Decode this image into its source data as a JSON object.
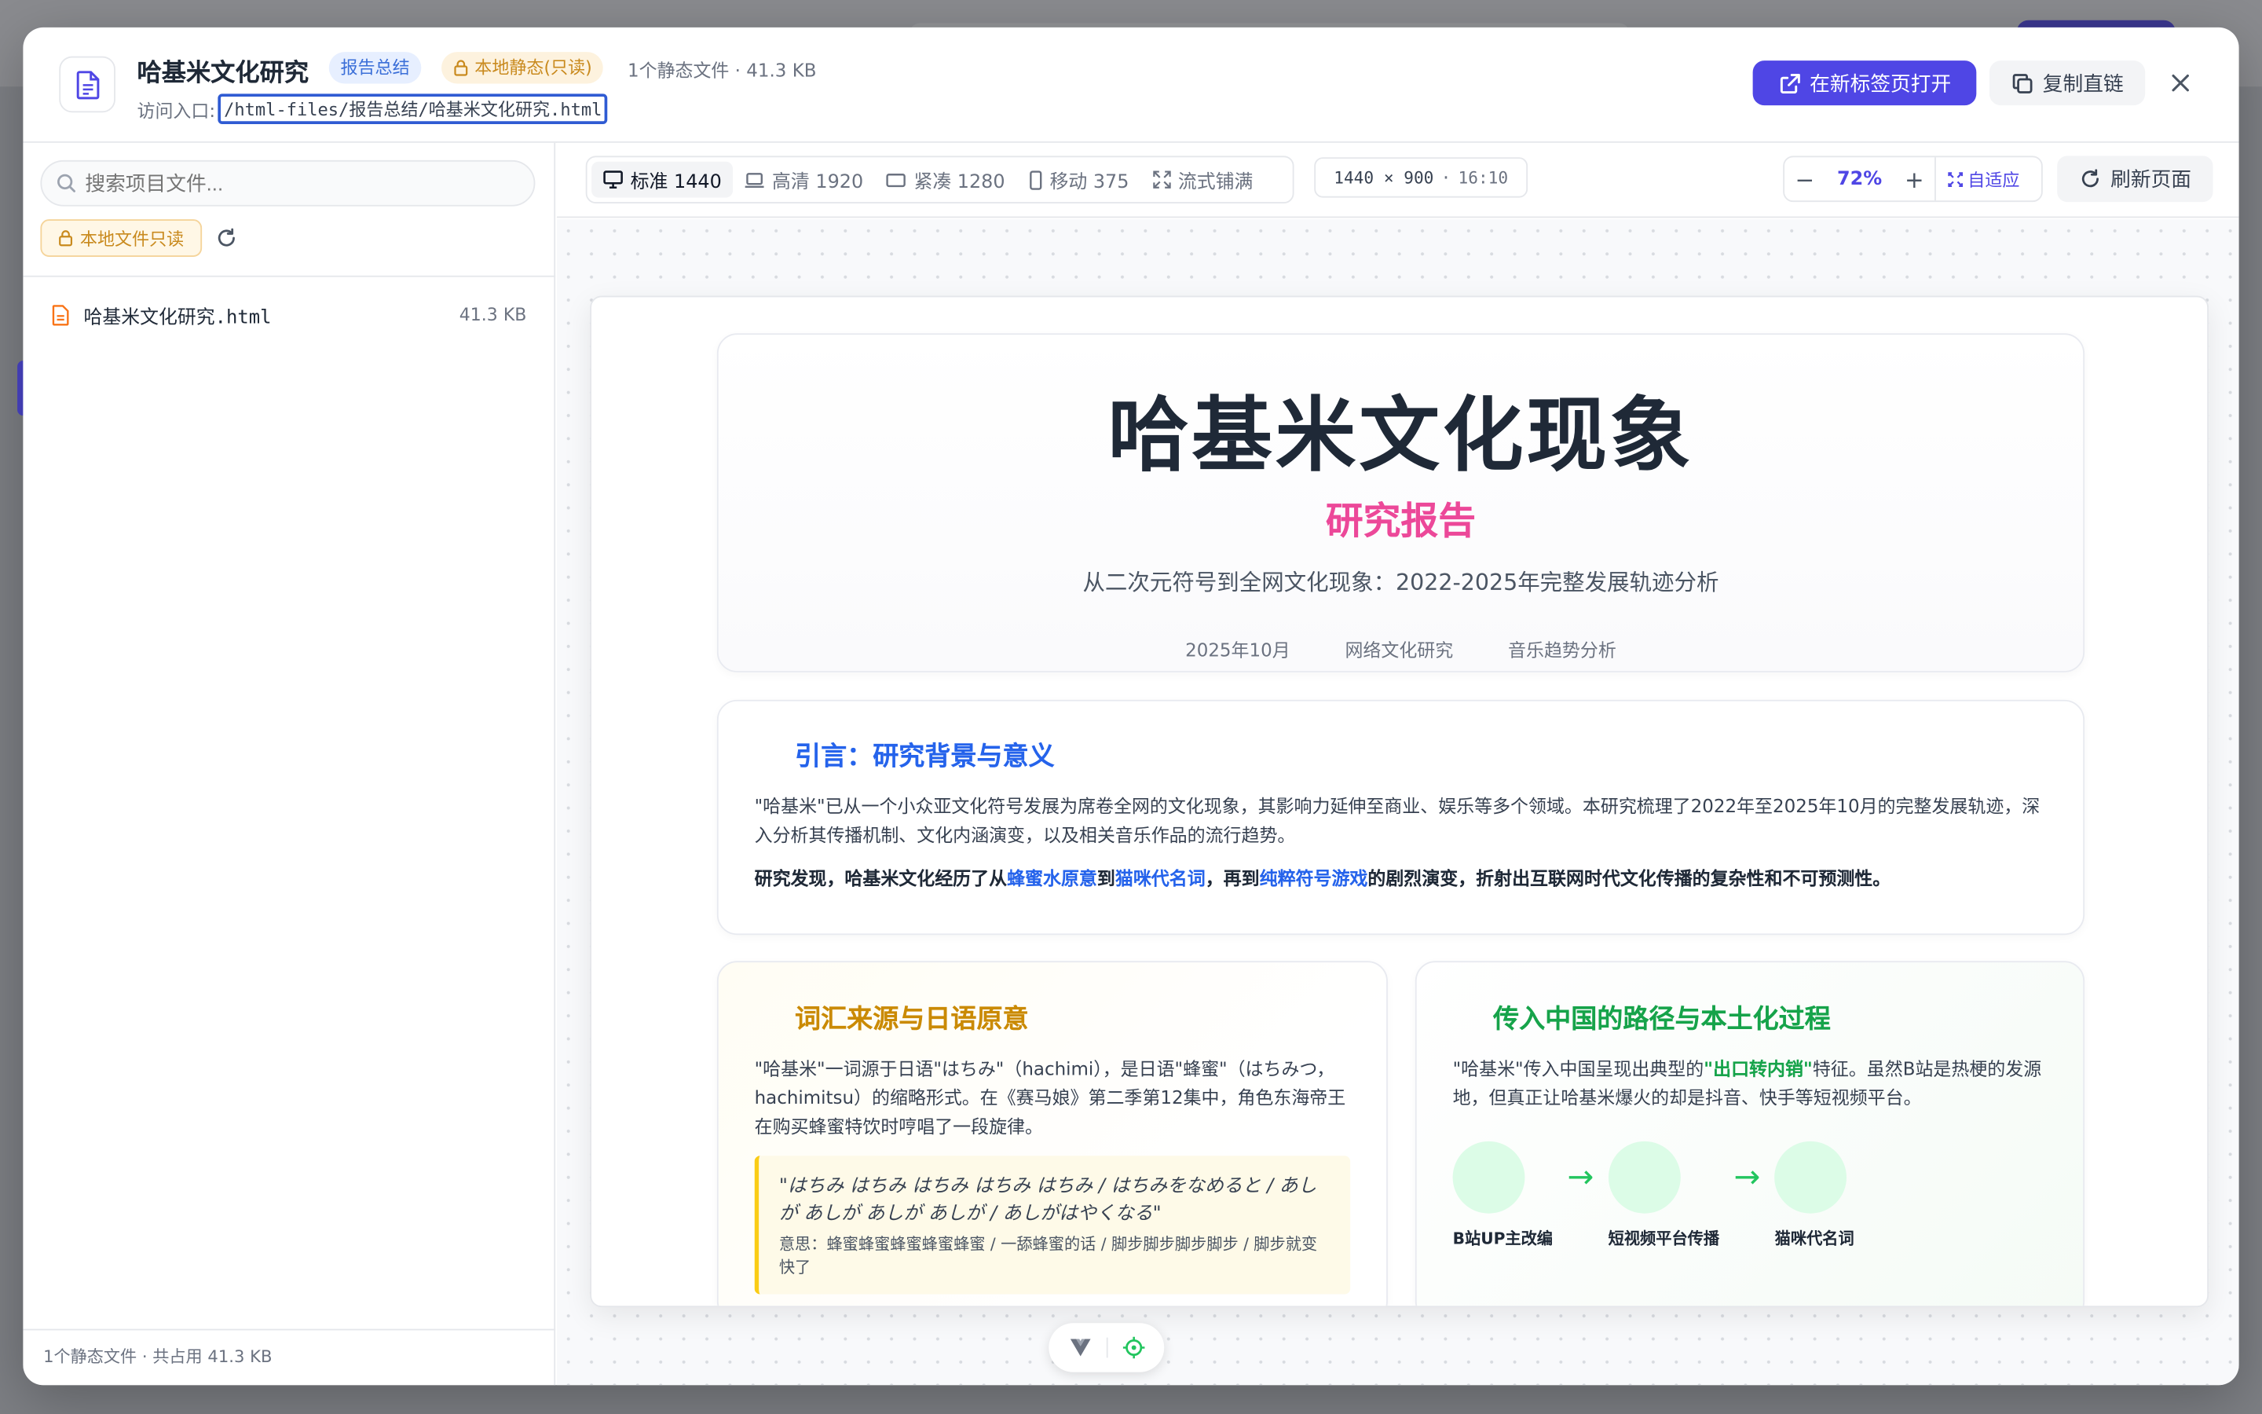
{
  "header": {
    "title": "哈基米文化研究",
    "tag_category": "报告总结",
    "tag_readonly": "本地静态(只读)",
    "meta": "1个静态文件 · 41.3 KB",
    "entry_label": "访问入口:",
    "entry_path": "/html-files/报告总结/哈基米文化研究.html",
    "open_new_tab": "在新标签页打开",
    "copy_link": "复制直链"
  },
  "sidebar": {
    "search_placeholder": "搜索项目文件...",
    "readonly_label": "本地文件只读",
    "files": [
      {
        "name": "哈基米文化研究.html",
        "size": "41.3 KB"
      }
    ],
    "footer": "1个静态文件 · 共占用 41.3 KB"
  },
  "toolbar": {
    "devices": [
      {
        "label": "标准 1440",
        "icon": "monitor-icon",
        "active": true
      },
      {
        "label": "高清 1920",
        "icon": "laptop-icon",
        "active": false
      },
      {
        "label": "紧凑 1280",
        "icon": "tablet-landscape-icon",
        "active": false
      },
      {
        "label": "移动 375",
        "icon": "phone-icon",
        "active": false
      },
      {
        "label": "流式铺满",
        "icon": "expand-icon",
        "active": false
      }
    ],
    "dimension": "1440 × 900",
    "ratio": "16:10",
    "zoom_minus": "−",
    "zoom_value": "72%",
    "zoom_plus": "+",
    "zoom_fit": "自适应",
    "refresh": "刷新页面"
  },
  "preview": {
    "hero": {
      "title": "哈基米文化现象",
      "subtitle": "研究报告",
      "desc": "从二次元符号到全网文化现象：2022-2025年完整发展轨迹分析",
      "meta": [
        "2025年10月",
        "网络文化研究",
        "音乐趋势分析"
      ]
    },
    "intro": {
      "heading": "引言：研究背景与意义",
      "p1": "\"哈基米\"已从一个小众亚文化符号发展为席卷全网的文化现象，其影响力延伸至商业、娱乐等多个领域。本研究梳理了2022年至2025年10月的完整发展轨迹，深入分析其传播机制、文化内涵演变，以及相关音乐作品的流行趋势。",
      "p2_a": "研究发现，哈基米文化经历了从",
      "p2_em1": "蜂蜜水原意",
      "p2_b": "到",
      "p2_em2": "猫咪代名词",
      "p2_c": "，再到",
      "p2_em3": "纯粹符号游戏",
      "p2_d": "的剧烈演变，折射出互联网时代文化传播的复杂性和不可预测性。"
    },
    "origin": {
      "heading": "词汇来源与日语原意",
      "body": "\"哈基米\"一词源于日语\"はちみ\"（hachimi），是日语\"蜂蜜\"（はちみつ，hachimitsu）的缩略形式。在《赛马娘》第二季第12集中，角色东海帝王在购买蜂蜜特饮时哼唱了一段旋律。",
      "quote": "\"はちみ はちみ はちみ はちみ はちみ / はちみをなめると / あしが あしが あしが あしが / あしがはやくなる\"",
      "meaning": "意思：蜂蜜蜂蜜蜂蜜蜂蜜蜂蜜 / 一舔蜂蜜的话 / 脚步脚步脚步脚步 / 脚步就变快了"
    },
    "path": {
      "heading": "传入中国的路径与本土化过程",
      "body_a": "\"哈基米\"传入中国呈现出典型的",
      "body_em": "\"出口转内销\"",
      "body_b": "特征。虽然B站是热梗的发源地，但真正让哈基米爆火的却是抖音、快手等短视频平台。",
      "steps": [
        "B站UP主改编",
        "短视频平台传播",
        "猫咪代名词"
      ]
    }
  },
  "colors": {
    "accent": "#4f46e5",
    "hero_subtitle": "#ec4899",
    "intro_heading": "#2563eb",
    "origin_heading": "#ca8a04",
    "path_heading": "#16a34a",
    "readonly": "#c98a1e"
  }
}
